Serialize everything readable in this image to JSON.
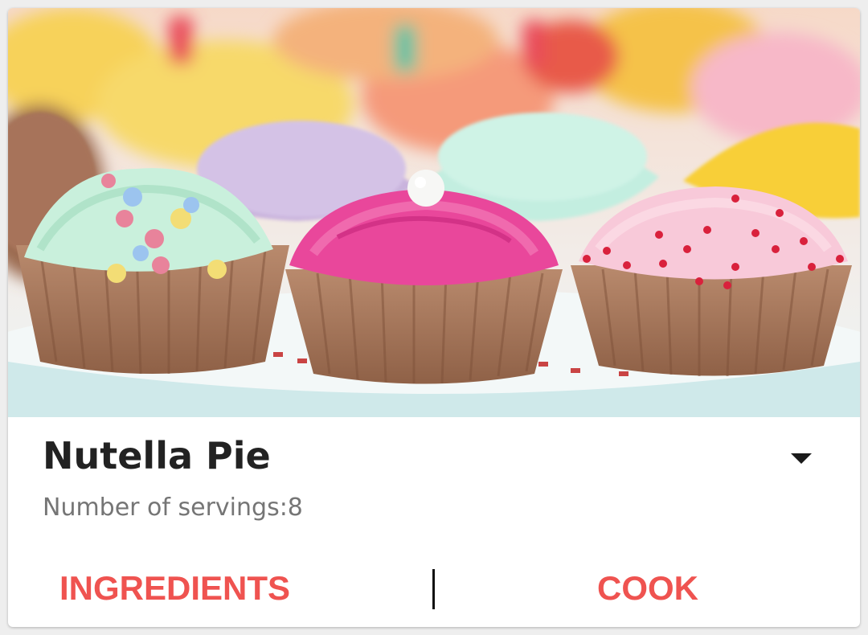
{
  "recipe": {
    "title": "Nutella Pie",
    "servings_text": "Number of servings:8"
  },
  "actions": {
    "ingredients_label": "INGREDIENTS",
    "cook_label": "COOK"
  },
  "icons": {
    "expand": "chevron-down-icon",
    "photo": "cupcakes-photo"
  },
  "colors": {
    "accent": "#ef5350",
    "title": "#222222",
    "subtitle": "#757575"
  }
}
